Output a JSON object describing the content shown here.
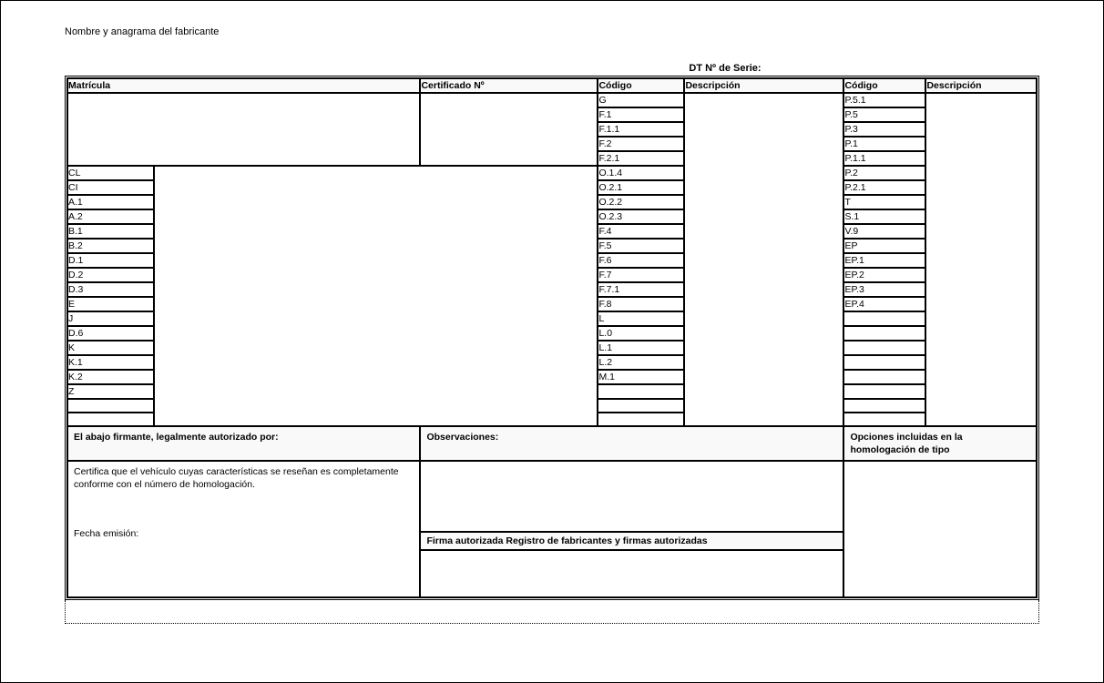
{
  "top": {
    "manufacturer_line": "Nombre y anagrama del fabricante",
    "serial_label": "DT    Nº de Serie:"
  },
  "headers": {
    "matricula": "Matrícula",
    "certificado": "Certificado Nº",
    "codigo": "Código",
    "descripcion": "Descripción"
  },
  "codes_mid": [
    "G",
    "F.1",
    "F.1.1",
    "F.2",
    "F.2.1",
    "O.1.4",
    "O.2.1",
    "O.2.2",
    "O.2.3",
    "F.4",
    "F.5",
    "F.6",
    "F.7",
    "F.7.1",
    "F.8",
    "L",
    "L.0",
    "L.1",
    "L.2",
    "M.1",
    "",
    "",
    ""
  ],
  "codes_right": [
    "P.5.1",
    "P.5",
    "P.3",
    "P.1",
    "P.1.1",
    "P.2",
    "P.2.1",
    "T",
    "S.1",
    "V.9",
    "EP",
    "EP.1",
    "EP.2",
    "EP.3",
    "EP.4",
    "",
    "",
    "",
    "",
    "",
    "",
    "",
    ""
  ],
  "codes_left": [
    "CL",
    "CI",
    "A.1",
    "A.2",
    "B.1",
    "B.2",
    "D.1",
    "D.2",
    "D.3",
    "E",
    "J",
    "D.6",
    "K",
    "K.1",
    "K.2",
    "Z",
    "",
    ""
  ],
  "bottom": {
    "signer_label": "El abajo firmante, legalmente autorizado por:",
    "certify_text": "Certifica que el vehículo cuyas características se reseñan es completamente conforme con el número de homologación.",
    "fecha_label": "Fecha emisión:",
    "observaciones_label": "Observaciones:",
    "firma_label": "Firma autorizada Registro de fabricantes y firmas autorizadas",
    "opciones_label": "Opciones incluidas en la homologación de tipo"
  }
}
